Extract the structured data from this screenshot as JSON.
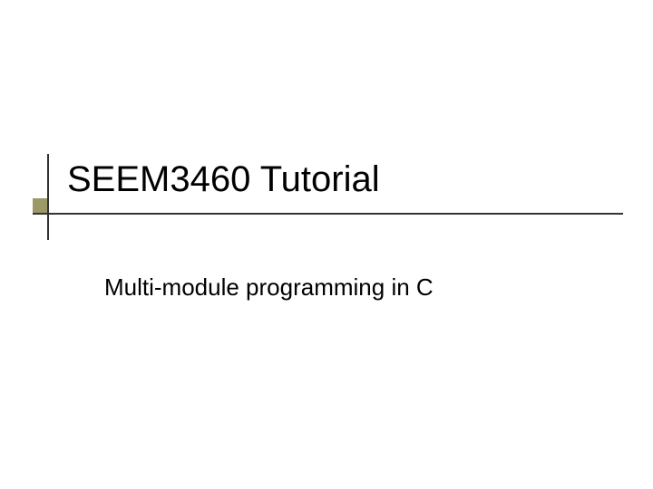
{
  "slide": {
    "title": "SEEM3460 Tutorial",
    "subtitle": "Multi-module programming in C"
  },
  "theme": {
    "accent_color": "#9a9967",
    "line_color": "#333333",
    "text_color": "#000000",
    "background": "#ffffff"
  }
}
